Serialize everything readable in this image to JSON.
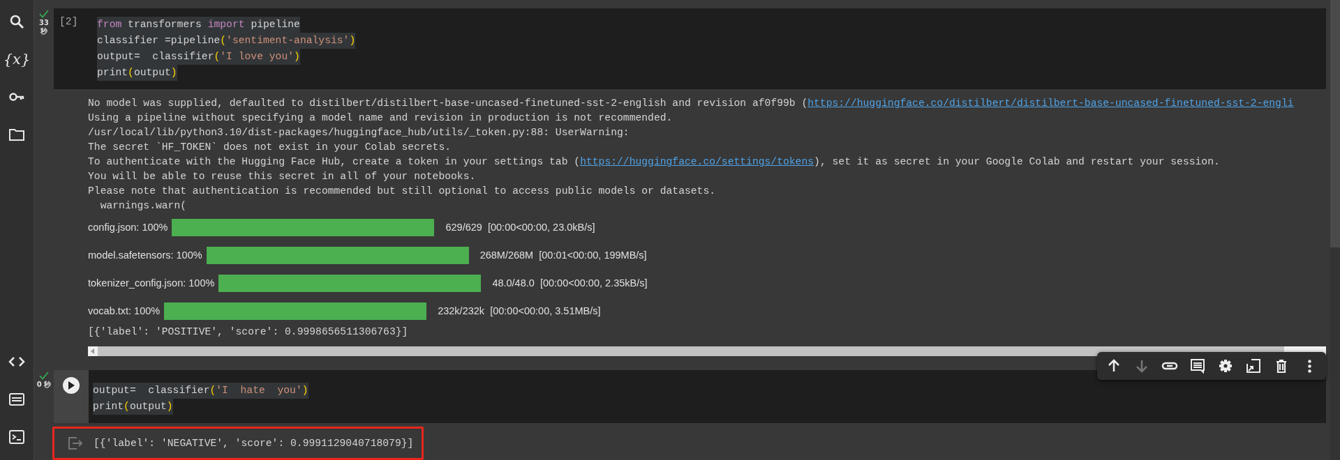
{
  "sidebar": {
    "top_items": [
      {
        "kind": "search"
      },
      {
        "kind": "variables",
        "label": "{x}"
      },
      {
        "kind": "secrets"
      },
      {
        "kind": "files"
      }
    ],
    "bottom_items": [
      {
        "kind": "code"
      },
      {
        "kind": "command-palette"
      },
      {
        "kind": "terminal"
      }
    ]
  },
  "cells": [
    {
      "kind": "numbered",
      "succeeded": true,
      "time_value": "33",
      "time_unit": "秒",
      "execution_count": "[2]",
      "code_lines": [
        [
          {
            "t": "from",
            "kind": "keyword"
          },
          {
            "t": " transformers ",
            "kind": "plain"
          },
          {
            "t": "import",
            "kind": "keyword"
          },
          {
            "t": " pipeline",
            "kind": "plain"
          }
        ],
        [
          {
            "t": "classifier =pipeline",
            "kind": "plain"
          },
          {
            "t": "(",
            "kind": "paren"
          },
          {
            "t": "'sentiment-analysis'",
            "kind": "string"
          },
          {
            "t": ")",
            "kind": "paren"
          }
        ],
        [
          {
            "t": "output=  classifier",
            "kind": "plain"
          },
          {
            "t": "(",
            "kind": "paren"
          },
          {
            "t": "'I love you'",
            "kind": "string"
          },
          {
            "t": ")",
            "kind": "paren"
          }
        ],
        [
          {
            "t": "print",
            "kind": "plain"
          },
          {
            "t": "(",
            "kind": "paren"
          },
          {
            "t": "output",
            "kind": "plain"
          },
          {
            "t": ")",
            "kind": "paren"
          }
        ]
      ],
      "output": [
        {
          "kind": "text",
          "segments": [
            {
              "t": "No model was supplied, defaulted to distilbert/distilbert-base-uncased-finetuned-sst-2-english and revision af0f99b (",
              "kind": "plain"
            },
            {
              "t": "https://huggingface.co/distilbert/distilbert-base-uncased-finetuned-sst-2-engli",
              "kind": "link"
            }
          ]
        },
        {
          "kind": "text",
          "segments": [
            {
              "t": "Using a pipeline without specifying a model name and revision in production is not recommended.",
              "kind": "plain"
            }
          ]
        },
        {
          "kind": "text",
          "segments": [
            {
              "t": "/usr/local/lib/python3.10/dist-packages/huggingface_hub/utils/_token.py:88: UserWarning:",
              "kind": "plain"
            }
          ]
        },
        {
          "kind": "text",
          "segments": [
            {
              "t": "The secret `HF_TOKEN` does not exist in your Colab secrets.",
              "kind": "plain"
            }
          ]
        },
        {
          "kind": "text",
          "segments": [
            {
              "t": "To authenticate with the Hugging Face Hub, create a token in your settings tab (",
              "kind": "plain"
            },
            {
              "t": "https://huggingface.co/settings/tokens",
              "kind": "link"
            },
            {
              "t": "), set it as secret in your Google Colab and restart your session.",
              "kind": "plain"
            }
          ]
        },
        {
          "kind": "text",
          "segments": [
            {
              "t": "You will be able to reuse this secret in all of your notebooks.",
              "kind": "plain"
            }
          ]
        },
        {
          "kind": "text",
          "segments": [
            {
              "t": "Please note that authentication is recommended but still optional to access public models or datasets.",
              "kind": "plain"
            }
          ]
        },
        {
          "kind": "text",
          "segments": [
            {
              "t": "  warnings.warn(",
              "kind": "plain"
            }
          ]
        },
        {
          "kind": "progress",
          "label": "config.json: 100%",
          "level": 1,
          "count": "629/629",
          "rate": "[00:00<00:00, 23.0kB/s]"
        },
        {
          "kind": "progress",
          "label": "model.safetensors: 100%",
          "level": 1,
          "count": "268M/268M",
          "rate": "[00:01<00:00, 199MB/s]"
        },
        {
          "kind": "progress",
          "label": "tokenizer_config.json: 100%",
          "level": 1,
          "count": "48.0/48.0",
          "rate": "[00:00<00:00, 2.35kB/s]"
        },
        {
          "kind": "progress",
          "label": "vocab.txt: 100%",
          "level": 1,
          "count": "232k/232k",
          "rate": "[00:00<00:00, 3.51MB/s]"
        },
        {
          "kind": "text",
          "segments": [
            {
              "t": "[{'label': 'POSITIVE', 'score': 0.9998656511306763}]",
              "kind": "plain"
            }
          ]
        }
      ],
      "horizontal_scrollbar": true
    },
    {
      "kind": "runnable",
      "succeeded": true,
      "time_value": "0",
      "time_unit": "秒",
      "highlighted_output": true,
      "code_lines": [
        [
          {
            "t": "output=  classifier",
            "kind": "plain"
          },
          {
            "t": "(",
            "kind": "paren"
          },
          {
            "t": "'I  hate  you'",
            "kind": "string"
          },
          {
            "t": ")",
            "kind": "paren"
          }
        ],
        [
          {
            "t": "print",
            "kind": "plain"
          },
          {
            "t": "(",
            "kind": "paren"
          },
          {
            "t": "output",
            "kind": "plain"
          },
          {
            "t": ")",
            "kind": "paren"
          }
        ]
      ],
      "output": [
        {
          "kind": "text",
          "segments": [
            {
              "t": "[{'label': 'NEGATIVE', 'score': 0.9991129040718079}]",
              "kind": "plain"
            }
          ]
        }
      ],
      "toolbar": [
        {
          "kind": "move-up",
          "disabled": false
        },
        {
          "kind": "move-down",
          "disabled": true
        },
        {
          "kind": "link",
          "disabled": false
        },
        {
          "kind": "comment",
          "disabled": false
        },
        {
          "kind": "settings",
          "disabled": false
        },
        {
          "kind": "mirror",
          "disabled": false
        },
        {
          "kind": "delete",
          "disabled": false
        },
        {
          "kind": "more",
          "disabled": false
        }
      ]
    }
  ]
}
